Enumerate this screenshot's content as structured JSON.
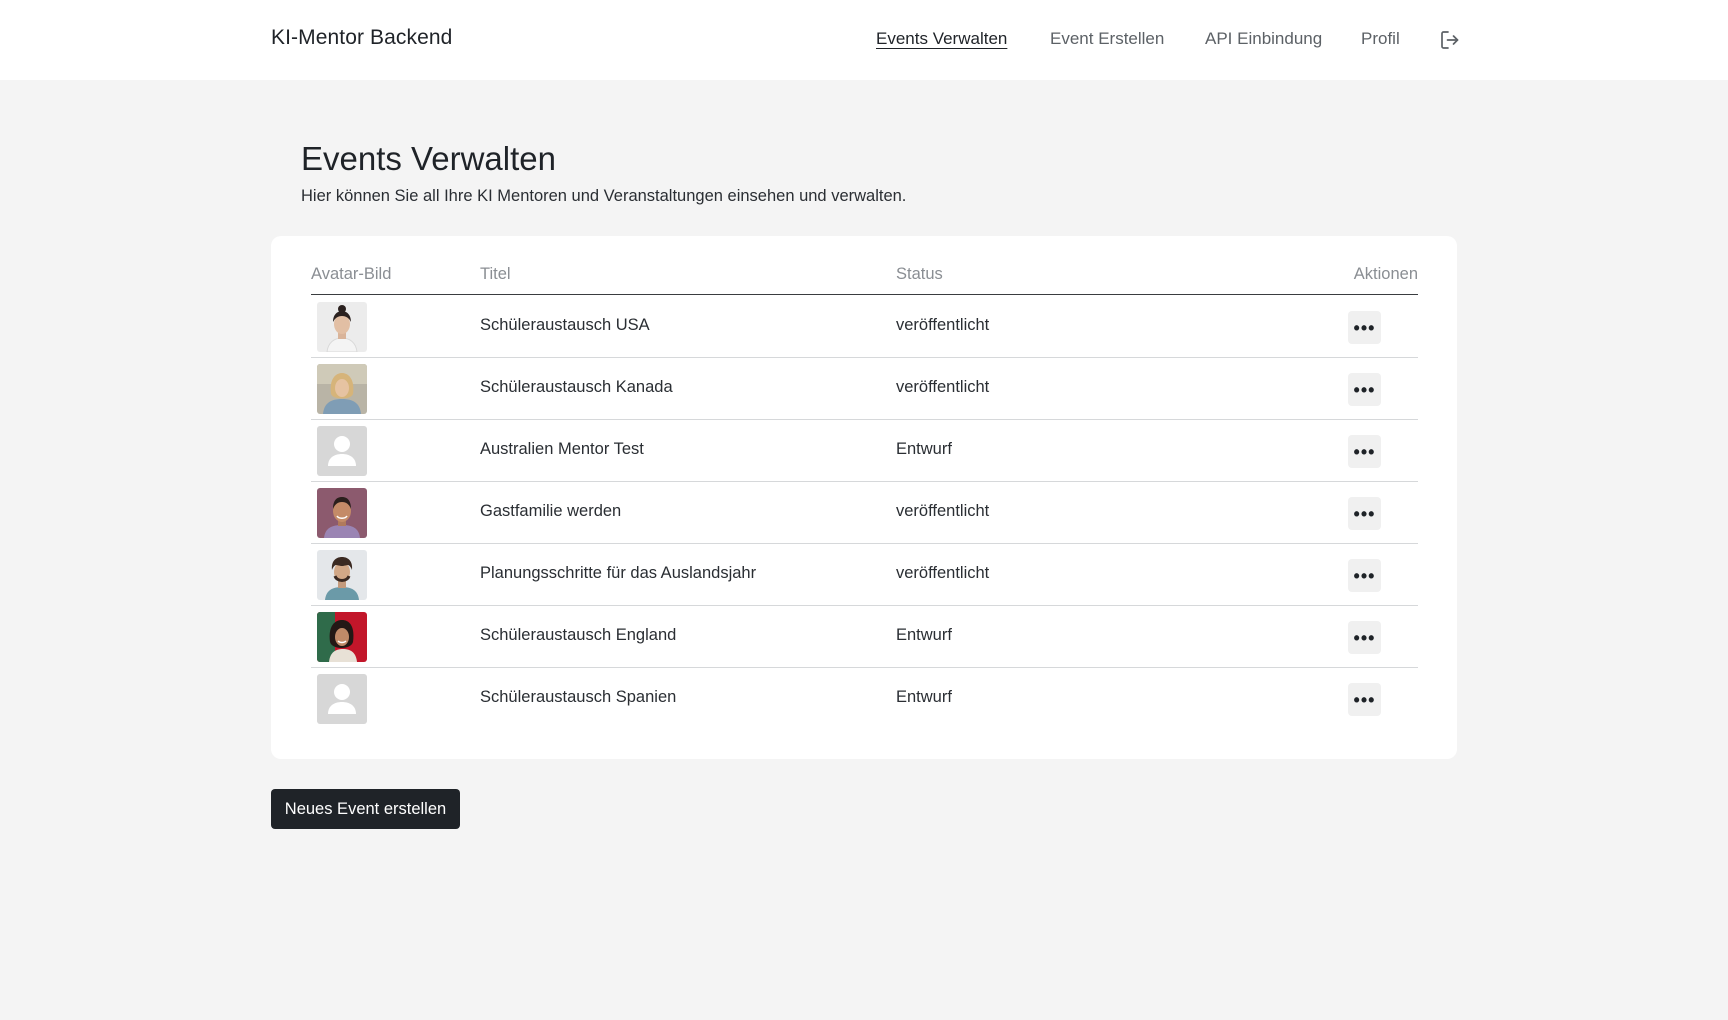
{
  "app": {
    "title": "KI-Mentor Backend"
  },
  "nav": {
    "items": [
      {
        "label": "Events Verwalten",
        "active": true
      },
      {
        "label": "Event Erstellen",
        "active": false
      },
      {
        "label": "API Einbindung",
        "active": false
      },
      {
        "label": "Profil",
        "active": false
      }
    ],
    "logout_icon": "logout-icon"
  },
  "page": {
    "title": "Events Verwalten",
    "subtitle": "Hier können Sie all Ihre KI Mentoren und Veranstaltungen einsehen und verwalten."
  },
  "table": {
    "columns": [
      "Avatar-Bild",
      "Titel",
      "Status",
      "Aktionen"
    ],
    "rows": [
      {
        "avatar": "photo-woman-dark-hair",
        "title": "Schüleraustausch USA",
        "status": "veröffentlicht",
        "action": "•••"
      },
      {
        "avatar": "photo-woman-blonde",
        "title": "Schüleraustausch Kanada",
        "status": "veröffentlicht",
        "action": "•••"
      },
      {
        "avatar": "placeholder-user-icon",
        "title": "Australien Mentor Test",
        "status": "Entwurf",
        "action": "•••"
      },
      {
        "avatar": "photo-man-smiling",
        "title": "Gastfamilie werden",
        "status": "veröffentlicht",
        "action": "•••"
      },
      {
        "avatar": "photo-man-curly-hair",
        "title": "Planungsschritte für das Auslandsjahr",
        "status": "veröffentlicht",
        "action": "•••"
      },
      {
        "avatar": "photo-woman-red-background",
        "title": "Schüleraustausch England",
        "status": "Entwurf",
        "action": "•••"
      },
      {
        "avatar": "placeholder-user-icon",
        "title": "Schüleraustausch Spanien",
        "status": "Entwurf",
        "action": "•••"
      }
    ]
  },
  "new_button": {
    "label": "Neues Event erstellen"
  },
  "colors": {
    "background": "#f4f4f4",
    "surface": "#ffffff",
    "primary_dark": "#1f2328",
    "muted_text": "#8a8e93",
    "action_bg": "#f0f0f0"
  }
}
